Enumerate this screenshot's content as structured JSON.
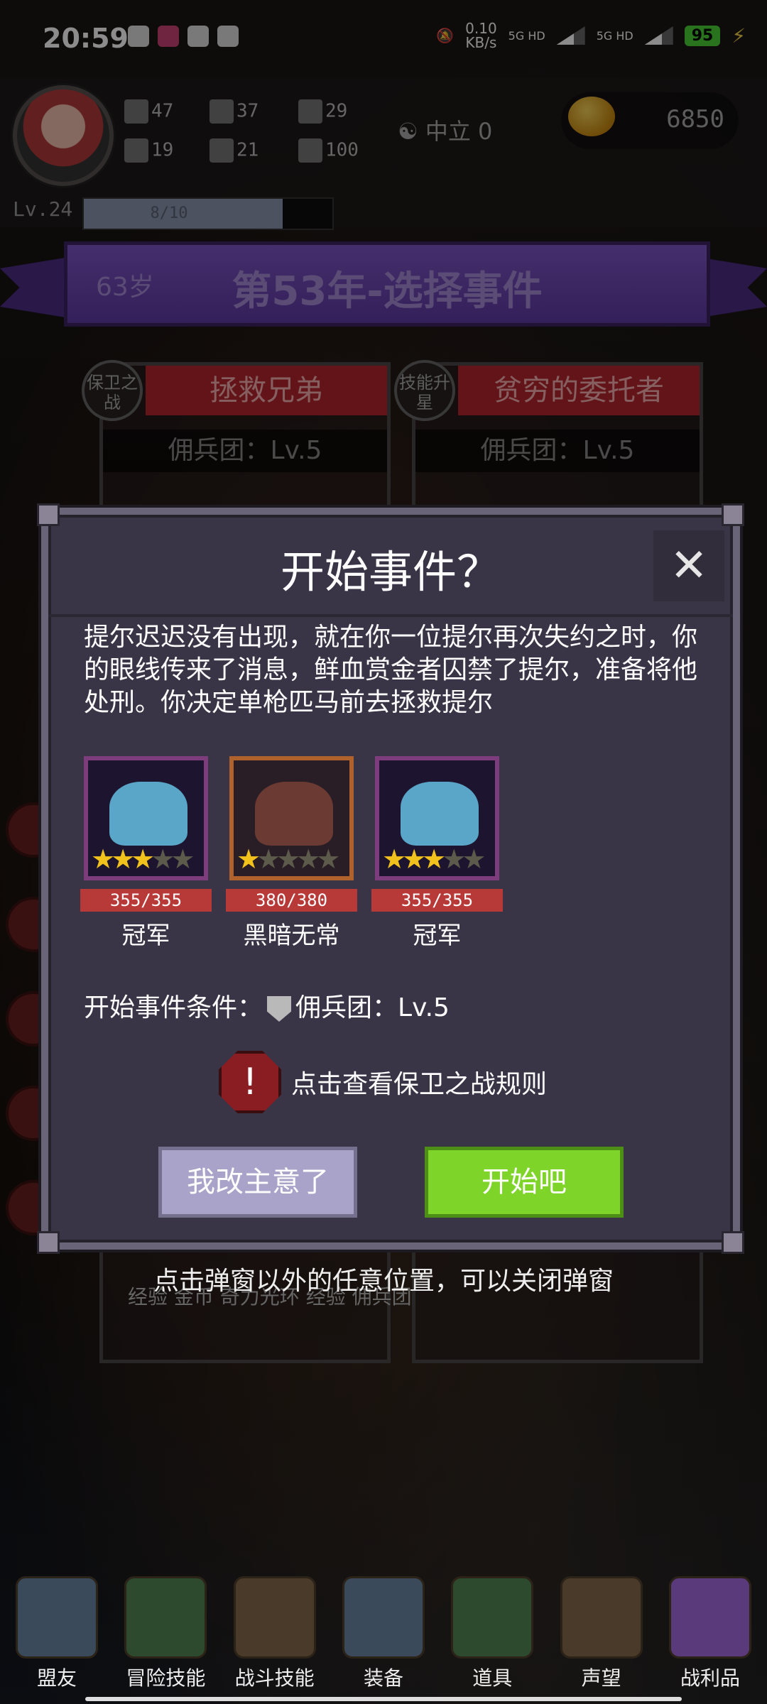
{
  "status_bar": {
    "time": "20:59",
    "net_speed": "0.10",
    "net_unit": "KB/s",
    "signal1": "5G HD",
    "signal2": "5G HD",
    "battery": "95"
  },
  "hud": {
    "stats": {
      "fist": "47",
      "boot": "37",
      "hat": "29",
      "clover": "19",
      "armor": "21",
      "wings": "100"
    },
    "alignment": "中立 0",
    "gold": "6850",
    "level": "Lv.24",
    "xp_text": "8/10",
    "xp_progress": 0.8
  },
  "banner": {
    "age": "63岁",
    "title": "第53年-选择事件"
  },
  "cards": [
    {
      "badge": "保卫之战",
      "title": "拯救兄弟",
      "requirement": "佣兵团：Lv.5"
    },
    {
      "badge": "技能升星",
      "title": "贫穷的委托者",
      "requirement": "佣兵团：Lv.5"
    }
  ],
  "modal": {
    "title": "开始事件？",
    "close": "✕",
    "description": "提尔迟迟没有出现，就在你一位提尔再次失约之时，你的眼线传来了消息，鲜血赏金者囚禁了提尔，准备将他处刑。你决定单枪匹马前去拯救提尔",
    "heroes": [
      {
        "hp": "355/355",
        "name": "冠军",
        "stars": 3,
        "max_stars": 5,
        "frame": "purple"
      },
      {
        "hp": "380/380",
        "name": "黑暗无常",
        "stars": 1,
        "max_stars": 5,
        "frame": "orange"
      },
      {
        "hp": "355/355",
        "name": "冠军",
        "stars": 3,
        "max_stars": 5,
        "frame": "purple"
      }
    ],
    "condition_label": "开始事件条件：",
    "condition_value": "佣兵团：Lv.5",
    "rules_link": "点击查看保卫之战规则",
    "cancel_button": "我改主意了",
    "start_button": "开始吧"
  },
  "hint": "点击弹窗以外的任意位置，可以关闭弹窗",
  "behind_labels": "经验  金币  奇力光环   经验  佣兵团",
  "nav": [
    {
      "label": "盟友",
      "icon": "handshake-icon"
    },
    {
      "label": "冒险技能",
      "icon": "book-icon"
    },
    {
      "label": "战斗技能",
      "icon": "backpack-icon"
    },
    {
      "label": "装备",
      "icon": "swords-icon"
    },
    {
      "label": "道具",
      "icon": "bag-icon"
    },
    {
      "label": "声望",
      "icon": "scroll-icon"
    },
    {
      "label": "战利品",
      "icon": "chest-icon"
    }
  ]
}
